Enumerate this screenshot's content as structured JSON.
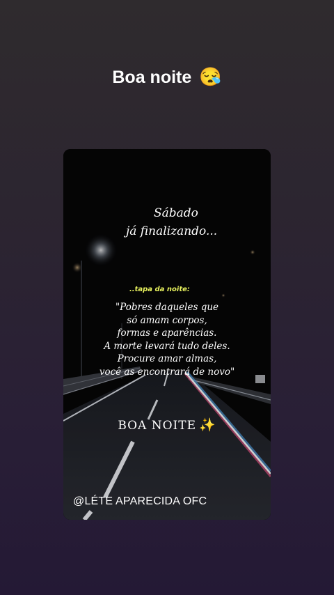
{
  "story": {
    "title": "Boa noite",
    "title_emoji": "😪"
  },
  "card": {
    "line1": "Sábado",
    "line2": "já finalizando...",
    "tag": "..tapa da noite:",
    "quote_lines": [
      "\"Pobres daqueles que",
      "só amam corpos,",
      "formas e aparências.",
      "A morte levará tudo deles.",
      "Procure amar almas,",
      "você as encontrará de novo\""
    ],
    "goodnight": "BOA NOITE",
    "goodnight_emoji": "✨",
    "credit": "@LÉTE APARECIDA OFC"
  },
  "colors": {
    "background_top": "#2f2b2e",
    "background_bottom": "#241935",
    "tag_color": "#e8f25e"
  },
  "icons": {
    "title_emoji": "sleepy-face-icon",
    "sparkles": "sparkles-icon"
  }
}
